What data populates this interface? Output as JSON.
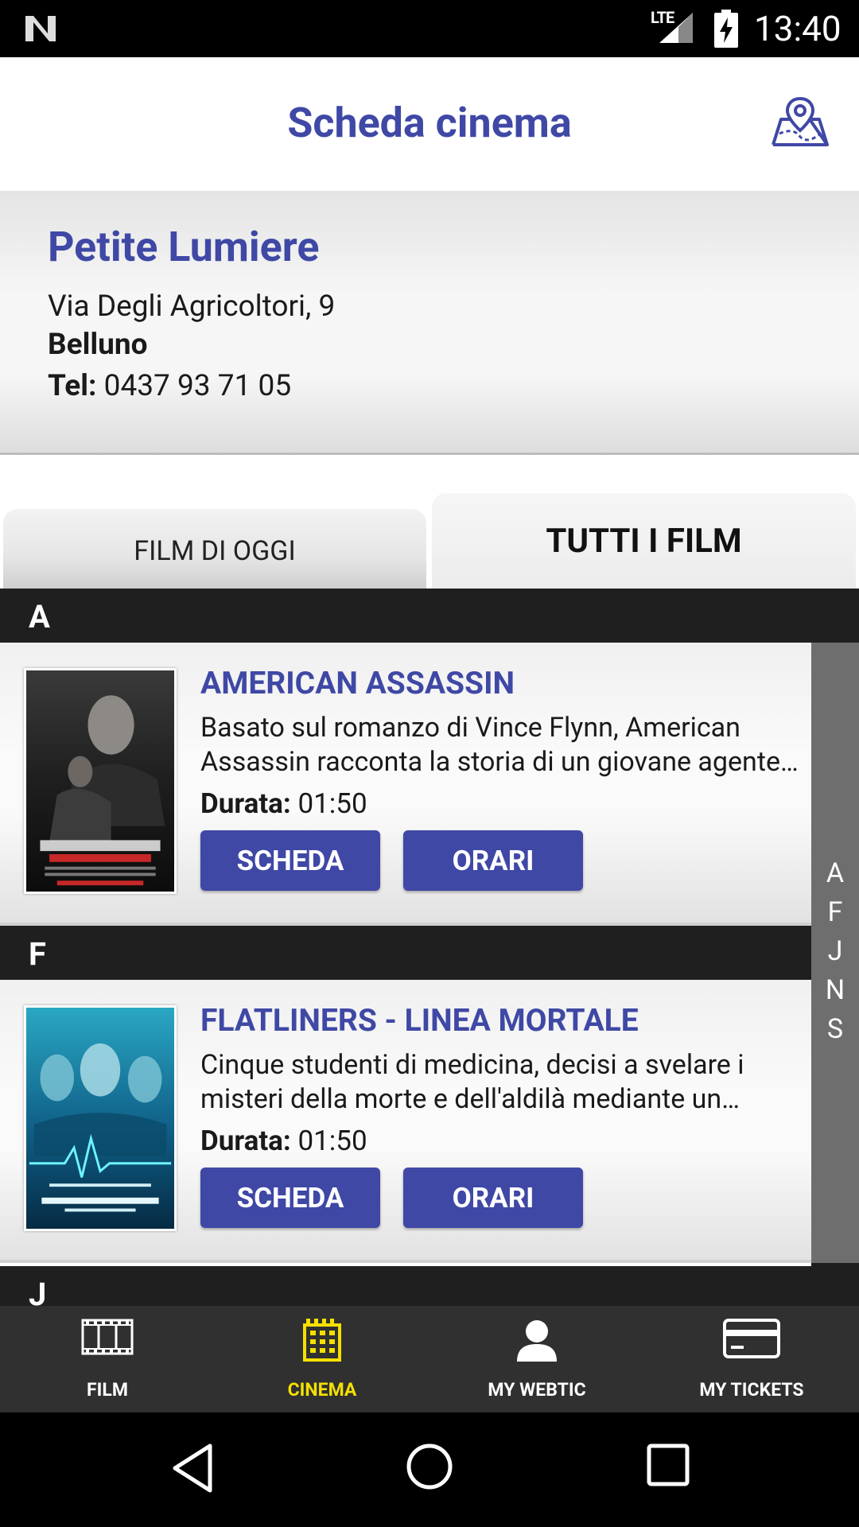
{
  "status_bar": {
    "network": "LTE",
    "time": "13:40"
  },
  "app_bar": {
    "title": "Scheda cinema",
    "map_icon": "map-pin-icon"
  },
  "cinema": {
    "name": "Petite Lumiere",
    "address": "Via Degli Agricoltori, 9",
    "city": "Belluno",
    "tel_label": "Tel:",
    "tel_value": "0437 93 71 05"
  },
  "tabs": [
    {
      "label": "FILM DI OGGI",
      "active": false
    },
    {
      "label": "TUTTI I FILM",
      "active": true
    }
  ],
  "sections": [
    {
      "letter": "A",
      "movies": [
        {
          "title": "AMERICAN ASSASSIN",
          "description": "Basato sul romanzo di Vince Flynn, American Assassin racconta la storia di un giovane agente della CIA...",
          "duration_label": "Durata:",
          "duration": "01:50",
          "btn_scheda": "SCHEDA",
          "btn_orari": "ORARI"
        }
      ]
    },
    {
      "letter": "F",
      "movies": [
        {
          "title": "FLATLINERS - LINEA MORTALE",
          "description": "Cinque studenti di medicina, decisi a svelare i misteri della morte e dell'aldilà mediante un esperimento...",
          "duration_label": "Durata:",
          "duration": "01:50",
          "btn_scheda": "SCHEDA",
          "btn_orari": "ORARI"
        }
      ]
    },
    {
      "letter": "J",
      "movies": []
    }
  ],
  "index_letters": [
    "A",
    "F",
    "J",
    "N",
    "S"
  ],
  "bottom_nav": [
    {
      "label": "FILM",
      "icon": "film-strip-icon",
      "active": false
    },
    {
      "label": "CINEMA",
      "icon": "building-icon",
      "active": true
    },
    {
      "label": "MY WEBTIC",
      "icon": "user-icon",
      "active": false
    },
    {
      "label": "MY TICKETS",
      "icon": "credit-card-icon",
      "active": false
    }
  ],
  "colors": {
    "accent": "#3f48a5",
    "active_nav": "#f5e000",
    "section_bg": "#1f1f1f",
    "nav_bg": "#303030"
  }
}
